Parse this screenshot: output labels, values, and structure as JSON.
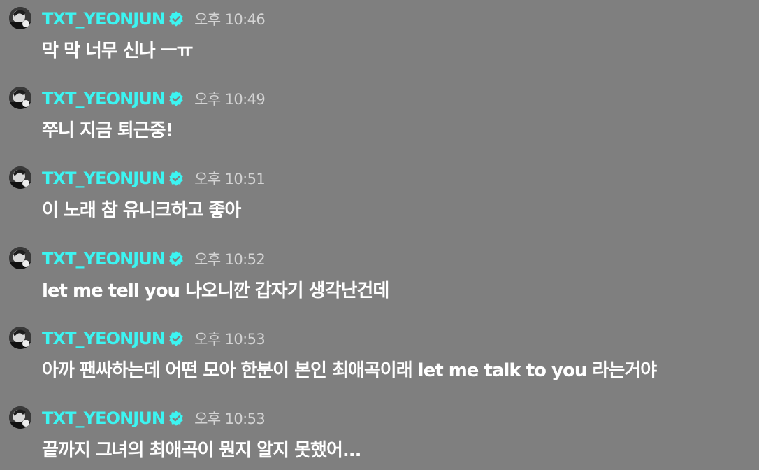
{
  "colors": {
    "background": "#7f7f7f",
    "username": "#3cf4f1",
    "verified_badge": "#3cf4f1",
    "timestamp": "#d4d4d4",
    "message": "#ffffff"
  },
  "icons": {
    "avatar": "avatar",
    "verified": "verified-badge-icon"
  },
  "posts": [
    {
      "username": "TXT_YEONJUN",
      "time": "오후 10:46",
      "message": "막 막 너무 신나 ㅡㅠ"
    },
    {
      "username": "TXT_YEONJUN",
      "time": "오후 10:49",
      "message": "쭈니 지금 퇴근중!"
    },
    {
      "username": "TXT_YEONJUN",
      "time": "오후 10:51",
      "message": "이 노래 참 유니크하고 좋아"
    },
    {
      "username": "TXT_YEONJUN",
      "time": "오후 10:52",
      "message": "let me tell you 나오니깐 갑자기 생각난건데"
    },
    {
      "username": "TXT_YEONJUN",
      "time": "오후 10:53",
      "message": "아까 팬싸하는데 어떤 모아 한분이 본인 최애곡이래 let me talk to you 라는거야"
    },
    {
      "username": "TXT_YEONJUN",
      "time": "오후 10:53",
      "message": "끝까지 그녀의 최애곡이 뭔지 알지 못했어..."
    }
  ]
}
